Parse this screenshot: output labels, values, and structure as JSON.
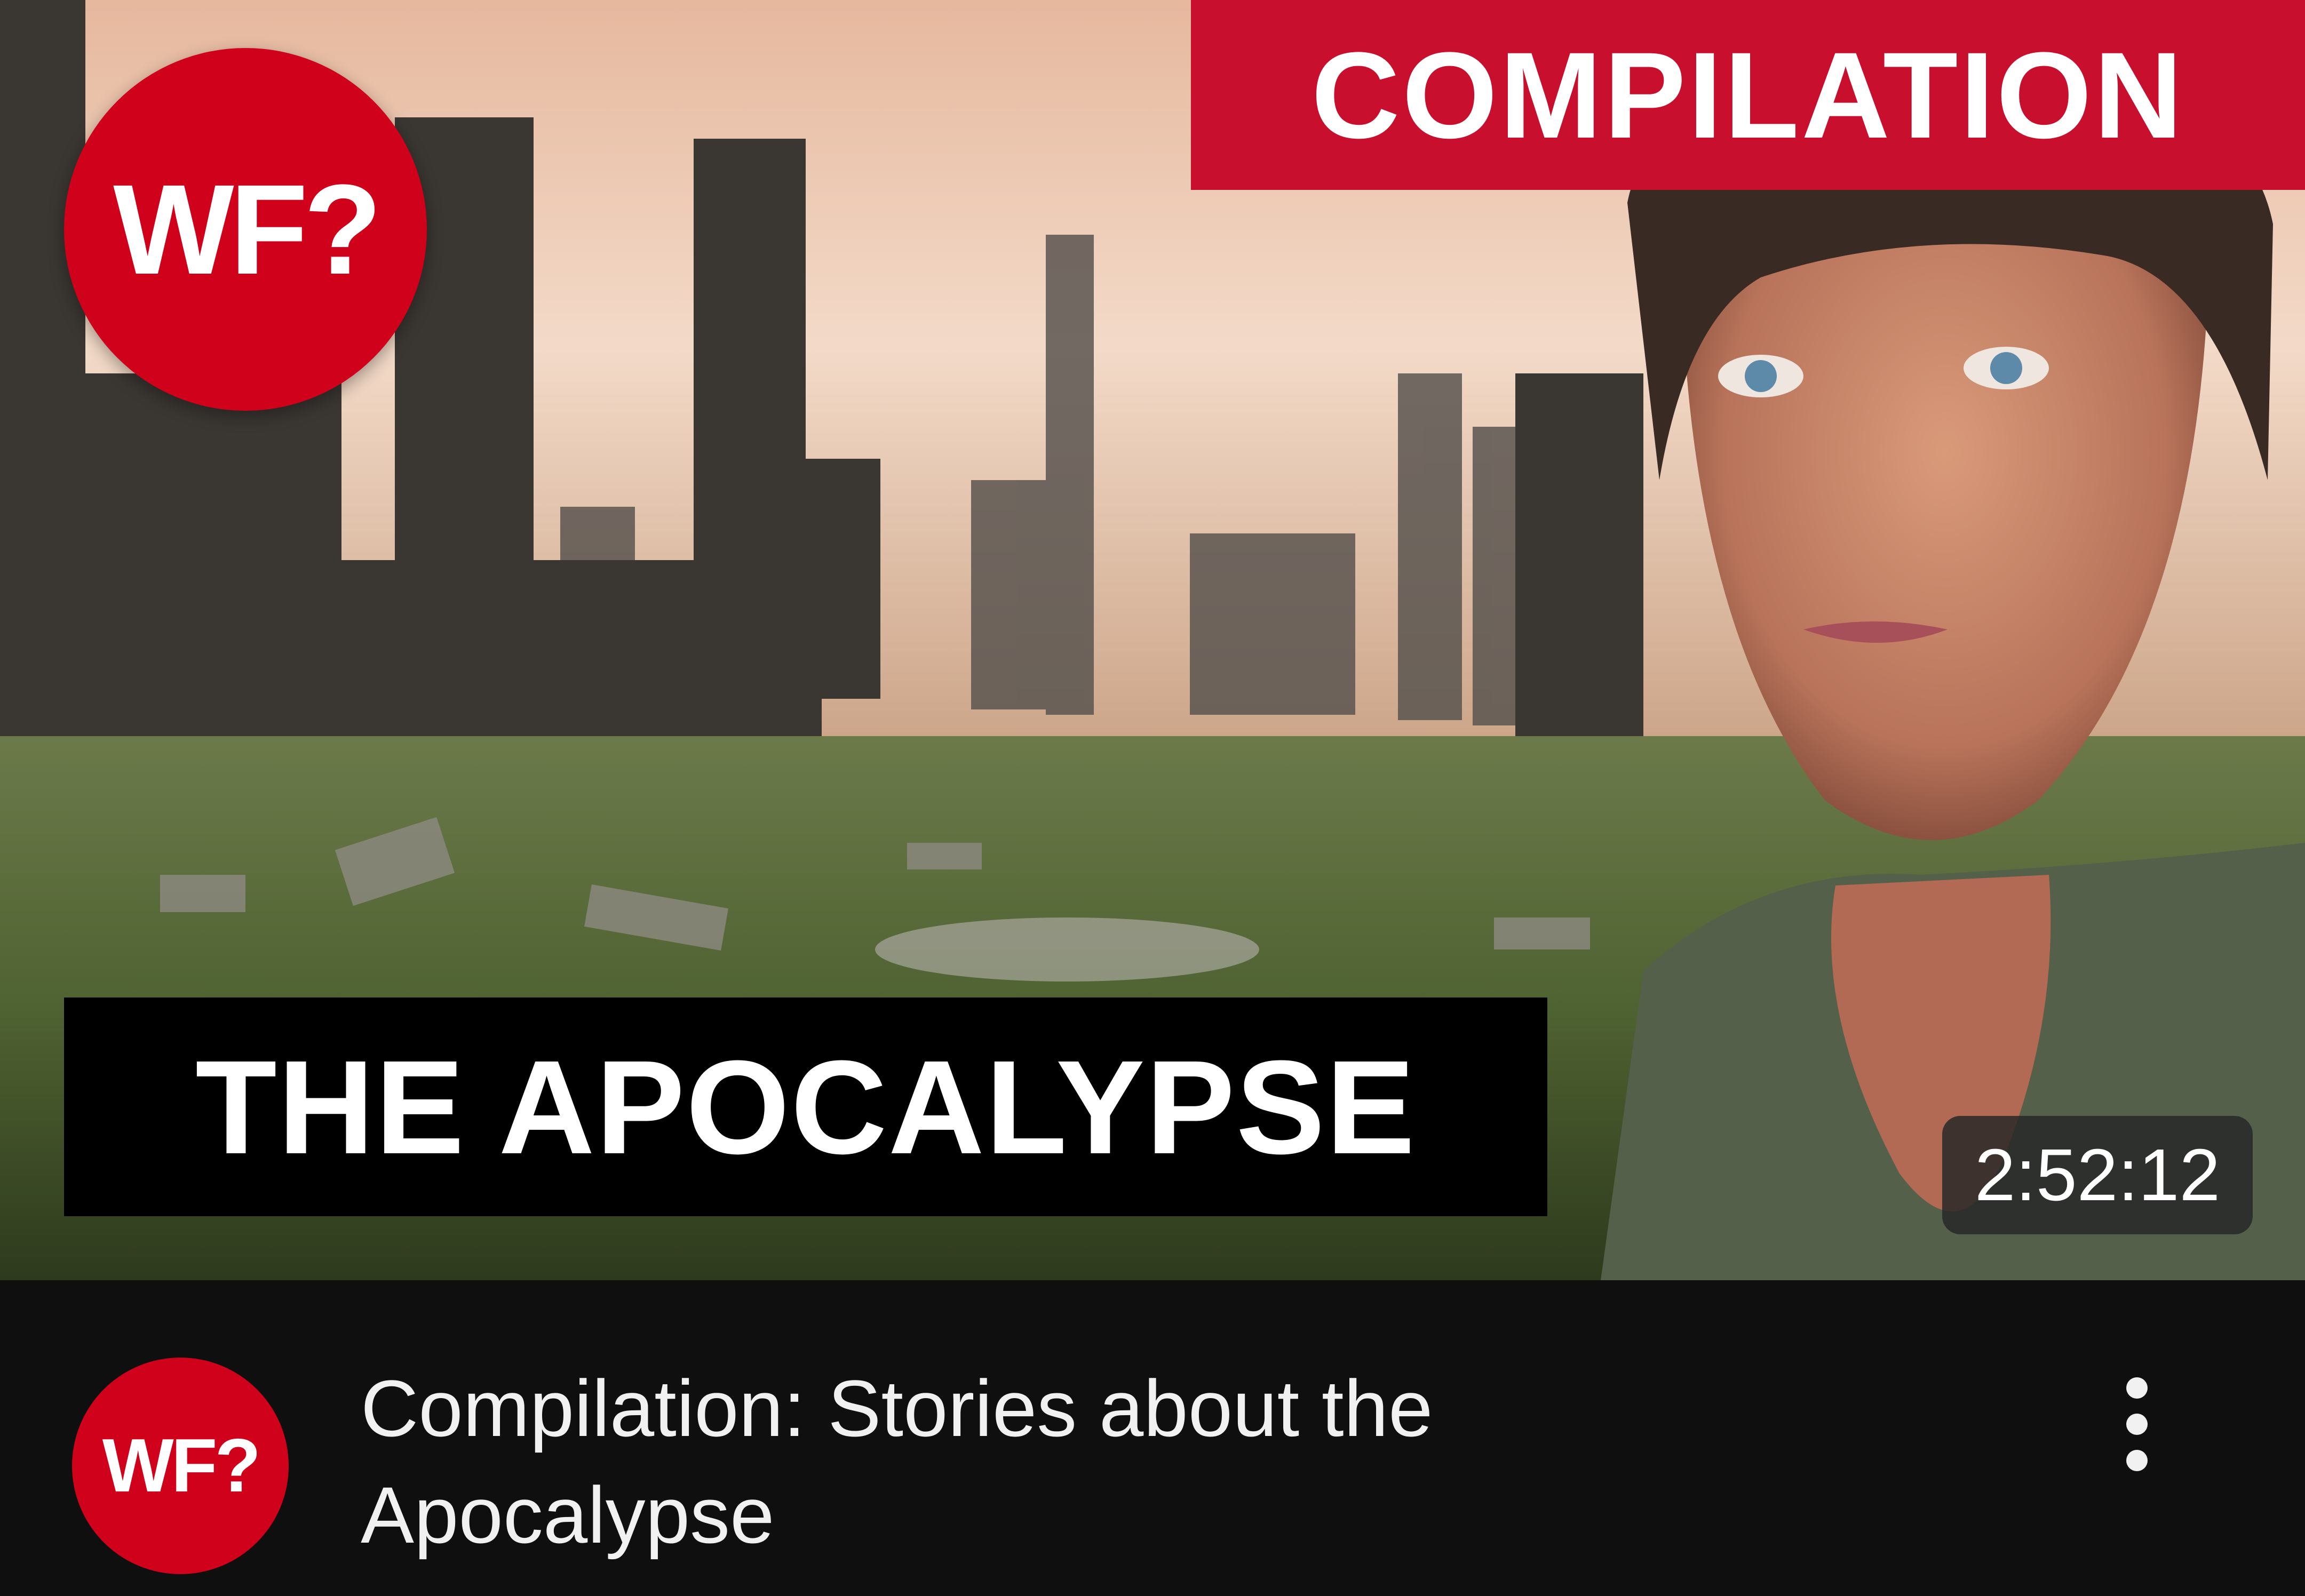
{
  "thumbnail": {
    "badge_text": "WF?",
    "compilation_label": "COMPILATION",
    "overlay_title": "THE APOCALYPSE",
    "duration": "2:52:12"
  },
  "video": {
    "channel_avatar_text": "WF?",
    "title": "Compilation: Stories about the Apocalypse",
    "more_icon": "vertical-ellipsis-icon"
  },
  "colors": {
    "brand_red": "#d0021b",
    "banner_red": "#c8102e",
    "background": "#0f0f0f",
    "text": "#f1f1f1"
  }
}
